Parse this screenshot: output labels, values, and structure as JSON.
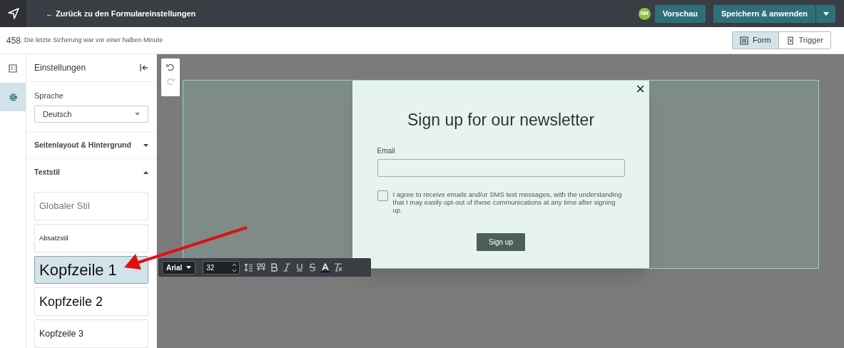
{
  "top_bar": {
    "back_link": "← Zurück zu den Formulareinstellungen",
    "avatar": "NM",
    "preview_button": "Vorschau",
    "save_button": "Speichern & anwenden"
  },
  "sub_bar": {
    "count": "458",
    "save_status": "Die letzte Sicherung war vor einer halben Minute",
    "view_tabs": [
      {
        "label": "Form",
        "selected": true
      },
      {
        "label": "Trigger",
        "selected": false
      }
    ]
  },
  "rail": [
    {
      "kind": "form",
      "selected": false
    },
    {
      "kind": "settings",
      "selected": true
    }
  ],
  "settings": {
    "title": "Einstellungen",
    "language_label": "Sprache",
    "language_value": "Deutsch",
    "sections": [
      {
        "label": "Seitenlayout & Hintergrund",
        "expanded": false
      },
      {
        "label": "Textstil",
        "expanded": true
      }
    ],
    "text_styles": [
      {
        "label": "Globaler Stil",
        "kind": "global",
        "selected": false
      },
      {
        "label": "Absatzstil",
        "kind": "paragraph",
        "selected": false
      },
      {
        "label": "Kopfzeile 1",
        "kind": "h1",
        "selected": true
      },
      {
        "label": "Kopfzeile 2",
        "kind": "h2",
        "selected": false
      },
      {
        "label": "Kopfzeile 3",
        "kind": "h3",
        "selected": false
      }
    ]
  },
  "popup": {
    "close": "×",
    "title": "Sign up for our newsletter",
    "email_label": "Email",
    "consent": "I agree to receive emails and/or SMS text messages, with the understanding that I may easily opt-out of these communications at any time after signing up.",
    "consent_checked": false,
    "submit": "Sign up"
  },
  "text_toolbar": {
    "font": "Arial",
    "size": "32"
  }
}
